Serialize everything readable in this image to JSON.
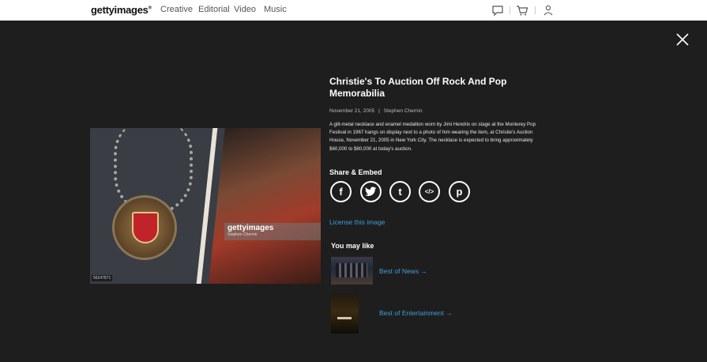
{
  "topbar": {
    "logo": "gettyimages",
    "logo_mark": "®",
    "nav": [
      "Creative",
      "Editorial",
      "Video",
      "Music"
    ],
    "icons": [
      "chat-icon",
      "cart-icon",
      "user-icon"
    ]
  },
  "image": {
    "watermark_brand": "gettyimages",
    "watermark_credit": "Stephen Chernin",
    "image_id": "56247871"
  },
  "detail": {
    "title": "Christie's To Auction Off Rock And Pop Memorabilia",
    "date": "November 21, 2005",
    "separator": "|",
    "photographer": "Stephen Chernin",
    "caption": "A gilt-metal necklace and enamel medallion worn by Jimi Hendrix on stage at the Monterey Pop Festival in 1967 hangs on display next to a photo of him wearing the item, at Christie's Auction House, November 21, 2005 in New York City. The necklace is expected to bring approximately $60,000 to $80,000 at today's auction."
  },
  "share": {
    "heading": "Share & Embed",
    "buttons": [
      {
        "icon": "facebook-icon",
        "glyph": "f"
      },
      {
        "icon": "twitter-icon",
        "glyph": "t"
      },
      {
        "icon": "tumblr-icon",
        "glyph": "t"
      },
      {
        "icon": "embed-icon",
        "glyph": "</>"
      },
      {
        "icon": "pinterest-icon",
        "glyph": "p"
      }
    ]
  },
  "license_label": "License this image",
  "you_may_like": {
    "heading": "You may like",
    "items": [
      {
        "label": "Best of News →"
      },
      {
        "label": "Best of Entertainment →"
      }
    ]
  },
  "colors": {
    "background": "#1f1e1e",
    "link": "#3aa0d8",
    "topbar": "#ffffff"
  }
}
